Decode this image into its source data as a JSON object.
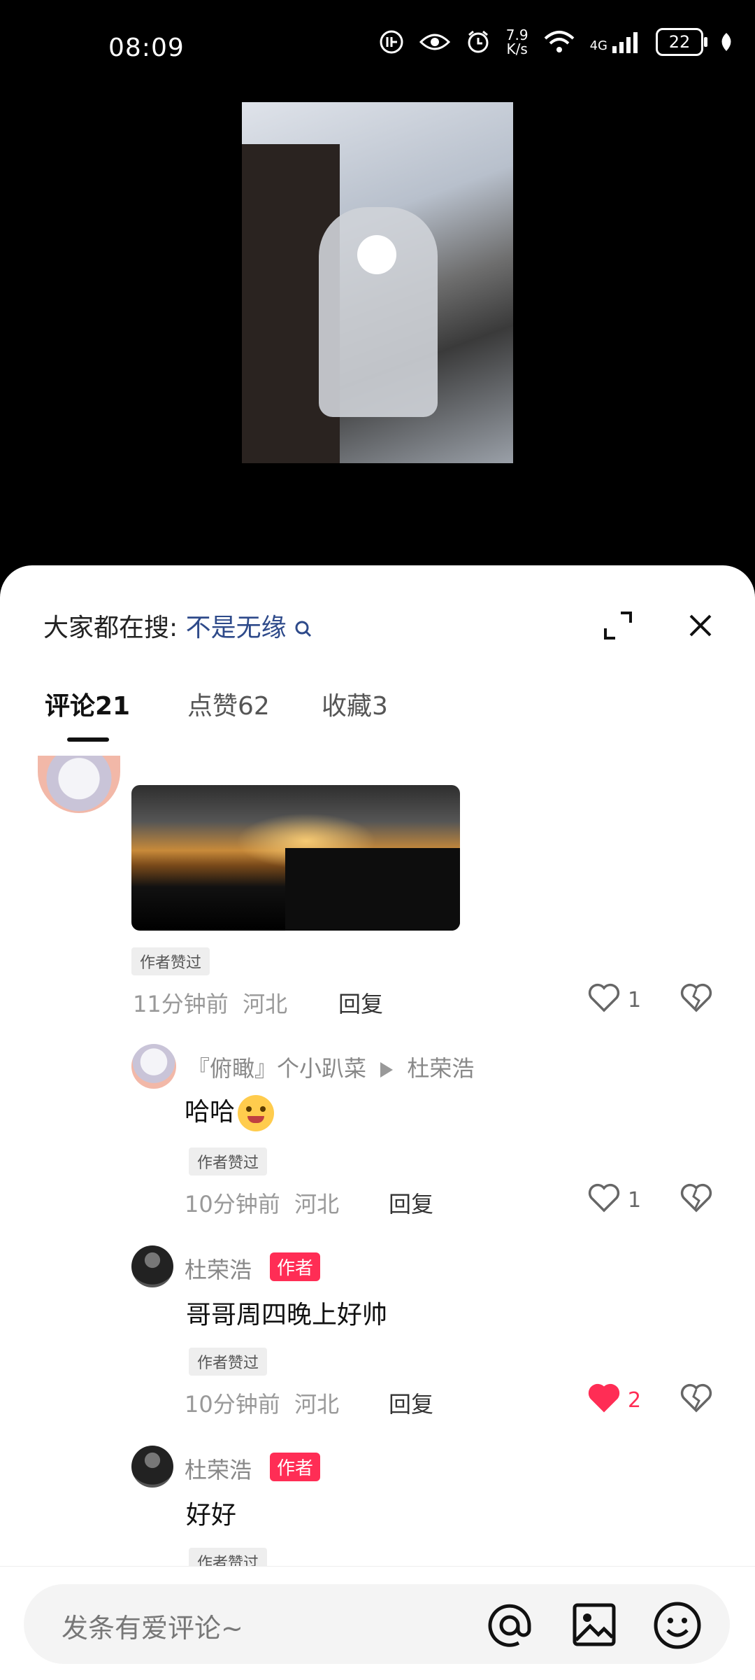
{
  "status_bar": {
    "time": "08:09",
    "net_speed_value": "7.9",
    "net_speed_unit": "K/s",
    "network_type": "4G",
    "battery": "22"
  },
  "sheet": {
    "search_prefix": "大家都在搜:",
    "search_keyword": "不是无缘",
    "tabs": [
      {
        "label": "评论21",
        "active": true
      },
      {
        "label": "点赞62",
        "active": false
      },
      {
        "label": "收藏3",
        "active": false
      }
    ]
  },
  "comments": [
    {
      "badge": "作者赞过",
      "time": "11分钟前",
      "location": "河北",
      "reply_label": "回复",
      "likes": "1"
    },
    {
      "user": "『俯瞰』个小趴菜",
      "reply_to": "杜荣浩",
      "text": "哈哈",
      "emoji": "thinking-emoji",
      "badge": "作者赞过",
      "time": "10分钟前",
      "location": "河北",
      "reply_label": "回复",
      "likes": "1"
    },
    {
      "user": "杜荣浩",
      "author_tag": "作者",
      "text": "哥哥周四晚上好帅",
      "badge": "作者赞过",
      "time": "10分钟前",
      "location": "河北",
      "reply_label": "回复",
      "likes": "2",
      "liked": true
    },
    {
      "user": "杜荣浩",
      "author_tag": "作者",
      "text": "好好",
      "badge": "作者赞过"
    }
  ],
  "input": {
    "placeholder": "发条有爱评论~"
  },
  "colors": {
    "accent": "#ff2d55",
    "keyword": "#2e4a8a"
  }
}
